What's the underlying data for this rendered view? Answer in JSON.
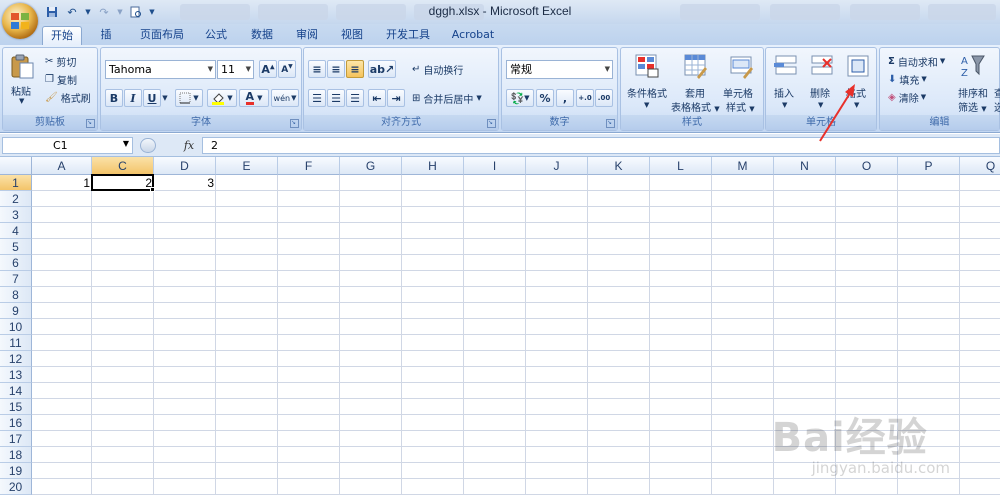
{
  "window": {
    "title": "dggh.xlsx - Microsoft Excel"
  },
  "tabs": [
    "开始",
    "插入",
    "页面布局",
    "公式",
    "数据",
    "审阅",
    "视图",
    "开发工具",
    "Acrobat"
  ],
  "ribbon": {
    "clipboard": {
      "paste": "粘贴",
      "cut": "剪切",
      "copy": "复制",
      "format_painter": "格式刷",
      "label": "剪贴板"
    },
    "font": {
      "name": "Tahoma",
      "size": "11",
      "bold": "B",
      "italic": "I",
      "underline": "U",
      "font_color_glyph": "A",
      "phonetic": "wén",
      "label": "字体"
    },
    "alignment": {
      "wrap_text": "自动换行",
      "merge_center": "合并后居中",
      "label": "对齐方式"
    },
    "number": {
      "format": "常规",
      "percent": "%",
      "comma": ",",
      "label": "数字"
    },
    "styles": {
      "conditional": "条件格式",
      "table_1": "套用",
      "table_2": "表格格式",
      "cell_style_1": "单元格",
      "cell_style_2": "样式",
      "label": "样式"
    },
    "cells": {
      "insert": "插入",
      "delete": "删除",
      "format": "格式",
      "label": "单元格"
    },
    "editing": {
      "autosum": "自动求和",
      "fill": "填充",
      "clear": "清除",
      "sort_1": "排序和",
      "sort_2": "筛选",
      "find_1": "查",
      "find_2": "选",
      "label": "编辑"
    }
  },
  "formula_bar": {
    "name_box": "C1",
    "fx": "fx",
    "content": "2"
  },
  "grid": {
    "columns": [
      "A",
      "C",
      "D",
      "E",
      "F",
      "G",
      "H",
      "I",
      "J",
      "K",
      "L",
      "M",
      "N",
      "O",
      "P",
      "Q"
    ],
    "rows": [
      "1",
      "2",
      "3",
      "4",
      "5",
      "6",
      "7",
      "8",
      "9",
      "10",
      "11",
      "12",
      "13",
      "14",
      "15",
      "16",
      "17",
      "18",
      "19",
      "20"
    ],
    "cells": [
      {
        "col": "A",
        "row": "1",
        "value": "1"
      },
      {
        "col": "C",
        "row": "1",
        "value": "2"
      },
      {
        "col": "D",
        "row": "1",
        "value": "3"
      }
    ],
    "active_cell": "C1"
  },
  "watermark": {
    "logo": "Bai经验",
    "url": "jingyan.baidu.com"
  },
  "colors": {
    "ribbon_bg": "#d2e2f7",
    "selected_header": "#f3c46a",
    "annotation_arrow": "#e8302a"
  }
}
